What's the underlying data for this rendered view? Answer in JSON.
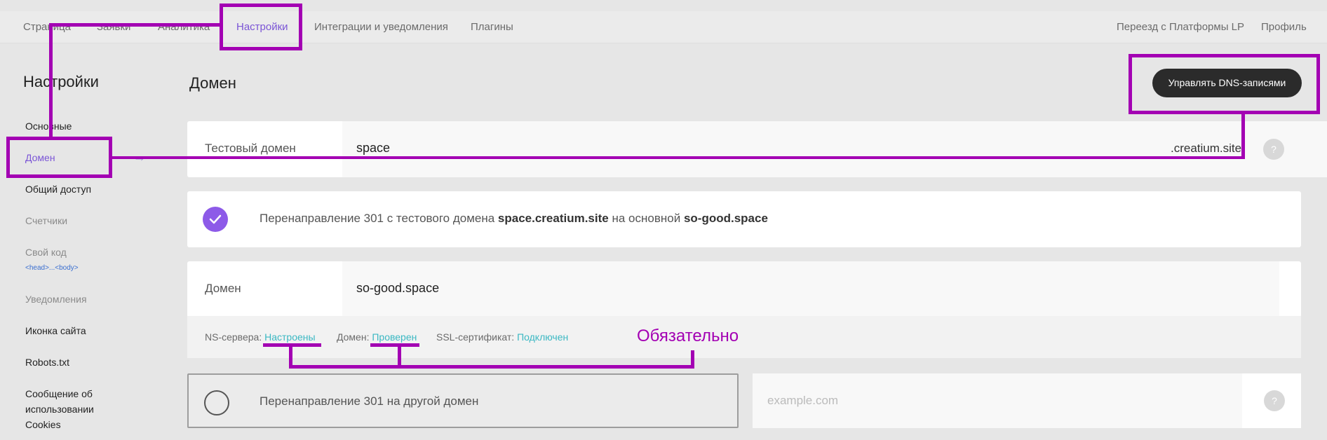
{
  "nav": {
    "items": [
      "Страница",
      "Заявки",
      "Аналитика",
      "Настройки",
      "Интеграции и уведомления",
      "Плагины"
    ],
    "right": [
      "Переезд с Платформы LP",
      "Профиль"
    ]
  },
  "sidebar": {
    "title": "Настройки",
    "items": [
      "Основные",
      "Домен",
      "Общий доступ",
      "Счетчики",
      "Свой код",
      "Уведомления",
      "Иконка сайта",
      "Robots.txt",
      "Сообщение об",
      "использовании",
      "Cookies"
    ],
    "code_hint": "<head>...<body>",
    "arrow": "→"
  },
  "main": {
    "title": "Домен",
    "dns_button": "Управлять DNS-записями",
    "test_domain": {
      "label": "Тестовый домен",
      "value": "space",
      "suffix": ".creatium.site",
      "help": "?"
    },
    "redirect_test": {
      "prefix": "Перенаправление 301 с тестового домена",
      "from": "space.creatium.site",
      "middle": "на основной",
      "to": "so-good.space"
    },
    "domain": {
      "label": "Домен",
      "value": "so-good.space"
    },
    "status": {
      "ns_label": "NS-сервера:",
      "ns_value": "Настроены",
      "domain_label": "Домен:",
      "domain_value": "Проверен",
      "ssl_label": "SSL-сертификат:",
      "ssl_value": "Подключен"
    },
    "redirect_other": {
      "label": "Перенаправление 301 на другой домен",
      "placeholder": "example.com",
      "help": "?"
    }
  },
  "annotation": {
    "text": "Обязательно",
    "color": "#a300b3"
  },
  "colors": {
    "accent": "#7b55d6",
    "check": "#8d5ae8",
    "ok": "#3bb8c3",
    "button": "#2b2b2b"
  }
}
